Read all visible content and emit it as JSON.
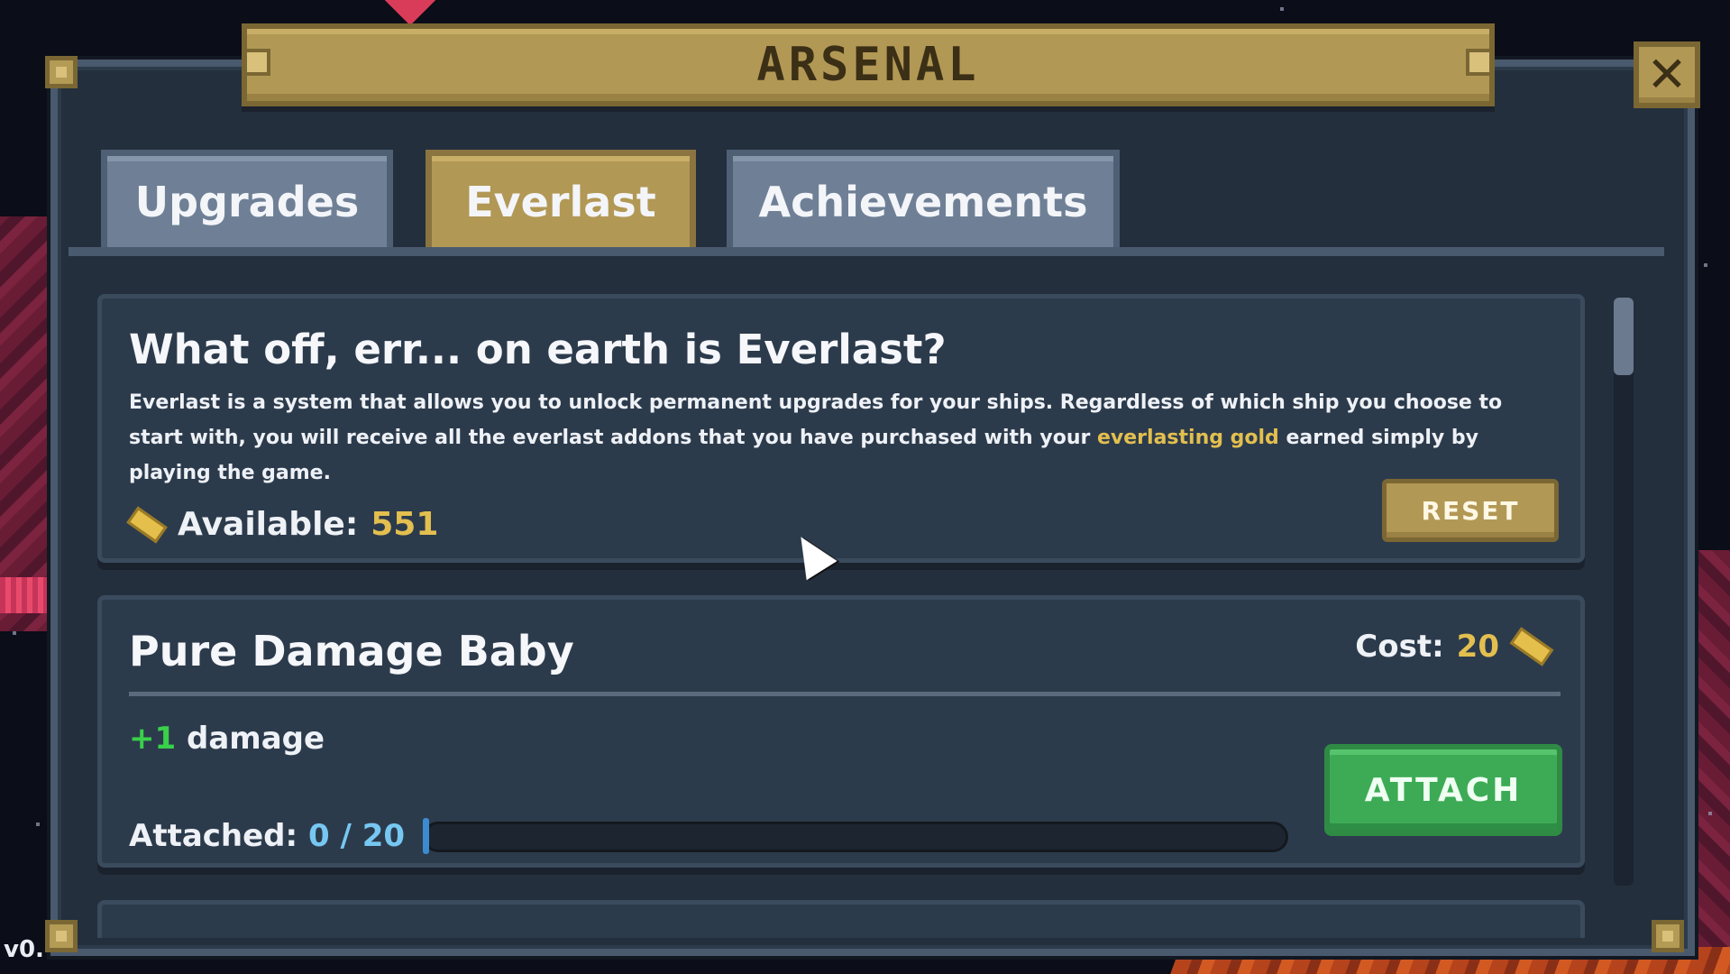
{
  "window": {
    "title": "ARSENAL",
    "close_glyph": "✕"
  },
  "tabs": [
    {
      "label": "Upgrades",
      "active": false
    },
    {
      "label": "Everlast",
      "active": true
    },
    {
      "label": "Achievements",
      "active": false
    }
  ],
  "info": {
    "title": "What off, err... on earth is Everlast?",
    "body_before": "Everlast is a system that allows you to unlock permanent upgrades for your ships. Regardless of which ship you choose to start with, you will receive all the everlast addons that you have purchased with your ",
    "body_highlight": "everlasting gold",
    "body_after": " earned simply by playing the game.",
    "available_label": "Available:",
    "available_value": "551",
    "reset_label": "RESET"
  },
  "upgrades": [
    {
      "name": "Pure Damage Baby",
      "cost_label": "Cost:",
      "cost_value": "20",
      "effect_amount": "+1",
      "effect_text": "damage",
      "attached_label": "Attached:",
      "attached_value": "0 / 20",
      "attached_fraction": 0.0,
      "attach_label": "ATTACH"
    }
  ],
  "version_text": "v0.",
  "colors": {
    "gold": "#e3bf4f",
    "green": "#3dab55",
    "tab_active": "#b29855",
    "tab_inactive": "#6f8096",
    "panel": "#2c3b4c"
  },
  "icons": [
    "close-icon",
    "gold-bar-icon",
    "cursor-icon"
  ]
}
